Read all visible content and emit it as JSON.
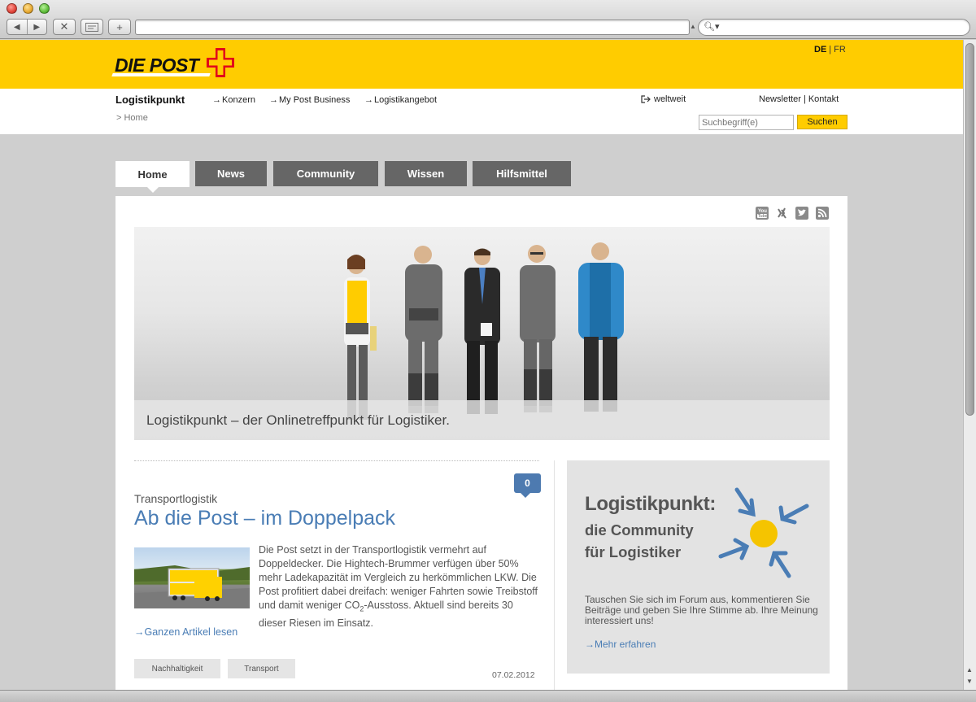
{
  "browser": {
    "nav_back": "◀",
    "nav_forward": "▶",
    "stop": "✕",
    "add_tab": "+",
    "url": "",
    "search": ""
  },
  "header": {
    "logo_text": "DIE POST",
    "lang_active": "DE",
    "lang_other": "FR",
    "site_name": "Logistikpunkt",
    "nav": [
      {
        "label": "Konzern"
      },
      {
        "label": "My Post Business"
      },
      {
        "label": "Logistikangebot"
      }
    ],
    "weltweit": "weltweit",
    "newsletter": "Newsletter",
    "kontakt": "Kontakt",
    "breadcrumb": "> Home",
    "search_placeholder": "Suchbegriff(e)",
    "search_button": "Suchen"
  },
  "tabs": [
    {
      "label": "Home",
      "active": true
    },
    {
      "label": "News"
    },
    {
      "label": "Community"
    },
    {
      "label": "Wissen"
    },
    {
      "label": "Hilfsmittel"
    }
  ],
  "social_icons": [
    "youtube-icon",
    "xing-icon",
    "twitter-icon",
    "rss-icon"
  ],
  "hero": {
    "caption": "Logistikpunkt – der Onlinetreffpunkt für Logistiker."
  },
  "article": {
    "comment_count": "0",
    "category": "Transportlogistik",
    "headline": "Ab die Post – im Doppelpack",
    "teaser_before_sub": "Die Post setzt in der Transportlogistik vermehrt auf Doppeldecker. Die Hightech-Brummer verfügen über 50% mehr Ladekapazität im Vergleich zu herkömmlichen LKW. Die Post profitiert dabei dreifach: weniger Fahrten sowie Treibstoff und damit weniger CO",
    "teaser_sub": "2",
    "teaser_after_sub": "-Ausstoss. Aktuell sind bereits 30 dieser Riesen im Einsatz.",
    "more_link": "Ganzen Artikel lesen",
    "tags": [
      "Nachhaltigkeit",
      "Transport"
    ],
    "date": "07.02.2012"
  },
  "promo": {
    "title": "Logistikpunkt:",
    "subtitle_line1": "die Community",
    "subtitle_line2": "für Logistiker",
    "body": "Tauschen Sie sich im Forum aus, kommentieren Sie Beiträge und geben Sie Ihre Stimme ab. Ihre Meinung interessiert uns!",
    "more_link": "Mehr erfahren"
  },
  "colors": {
    "brand_yellow": "#ffcc00",
    "tab_grey": "#666666",
    "link_blue": "#4a7db5",
    "cross_red": "#e2001a",
    "sun_yellow": "#f5c400",
    "arrow_blue": "#4a7db5"
  }
}
